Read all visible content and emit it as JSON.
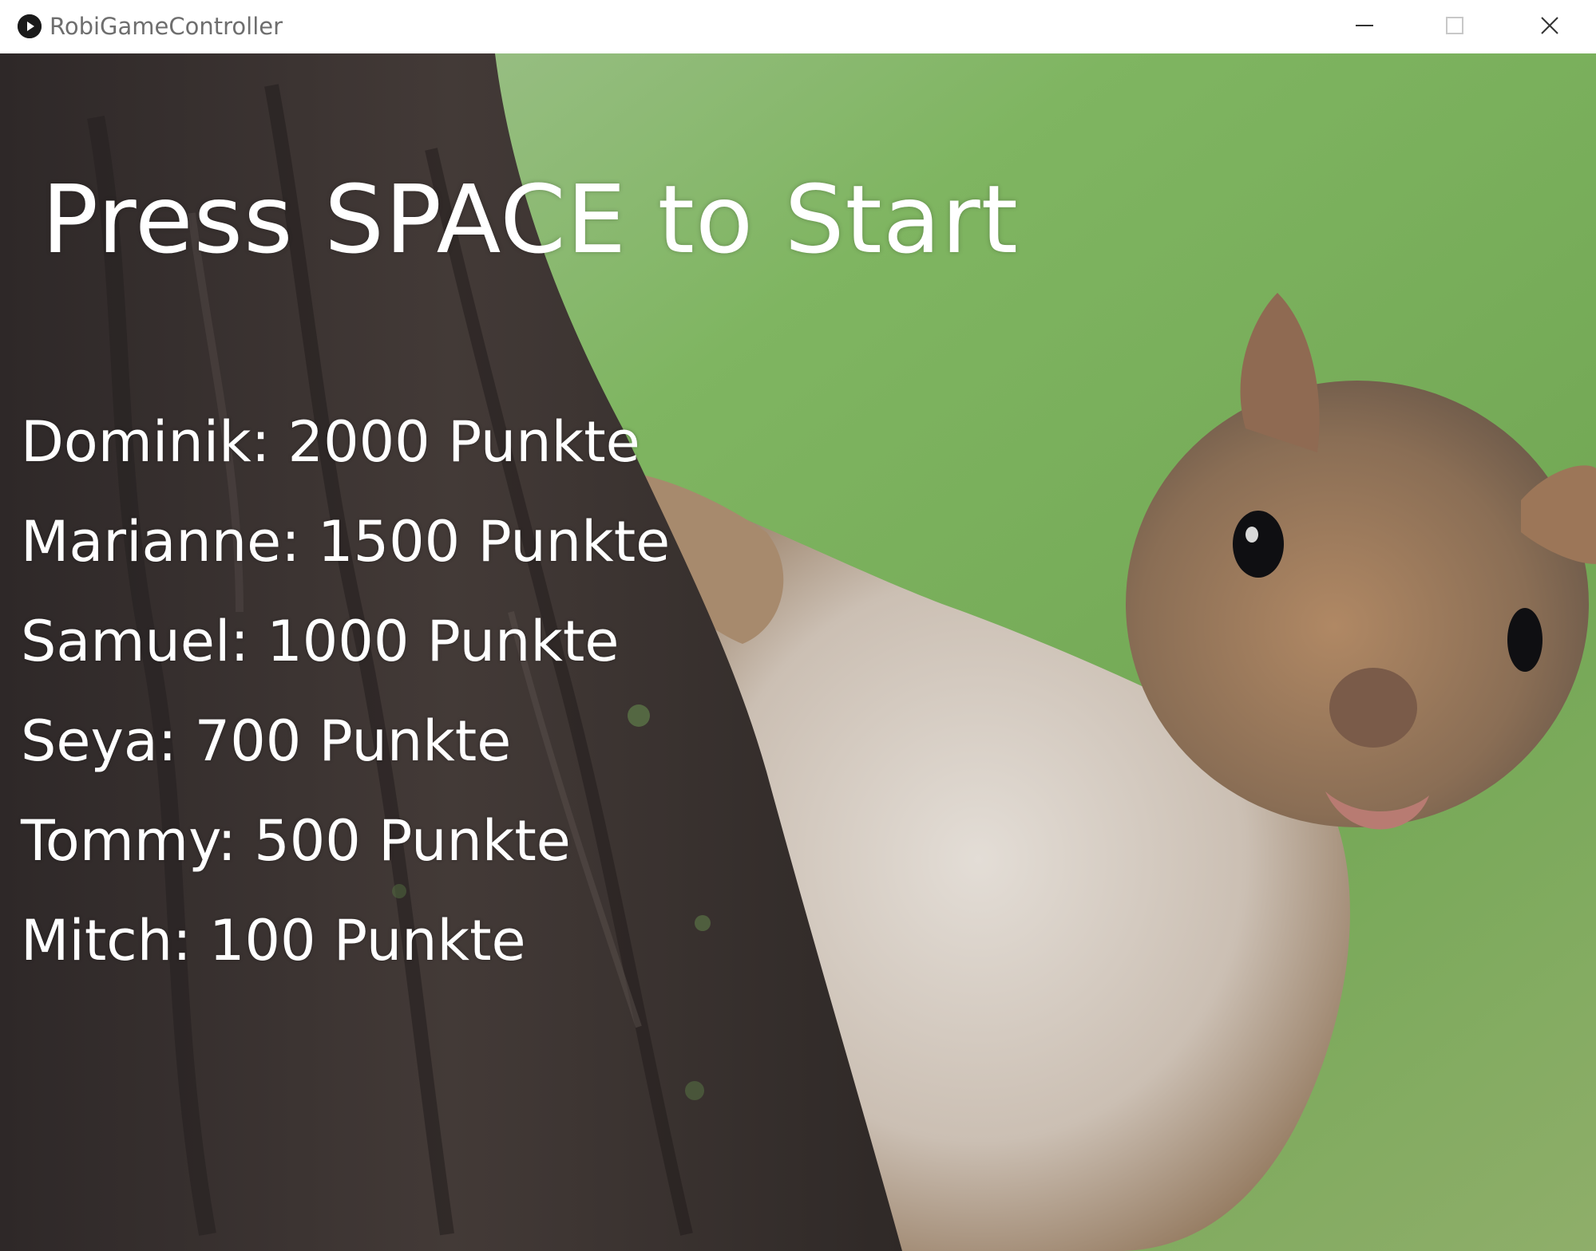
{
  "window": {
    "title": "RobiGameController",
    "controls": {
      "minimize_icon": "minimize-icon",
      "maximize_icon": "maximize-icon",
      "close_icon": "close-icon"
    }
  },
  "game": {
    "prompt": "Press SPACE to Start",
    "highscores": [
      {
        "text": "Dominik: 2000 Punkte"
      },
      {
        "text": "Marianne: 1500 Punkte"
      },
      {
        "text": "Samuel: 1000 Punkte"
      },
      {
        "text": "Seya: 700 Punkte"
      },
      {
        "text": "Tommy: 500 Punkte"
      },
      {
        "text": "Mitch: 100 Punkte"
      }
    ]
  },
  "colors": {
    "text": "#ffffff",
    "bark": "#3b3431",
    "foliage": "#7fb05e",
    "fur": "#9a7a58"
  }
}
